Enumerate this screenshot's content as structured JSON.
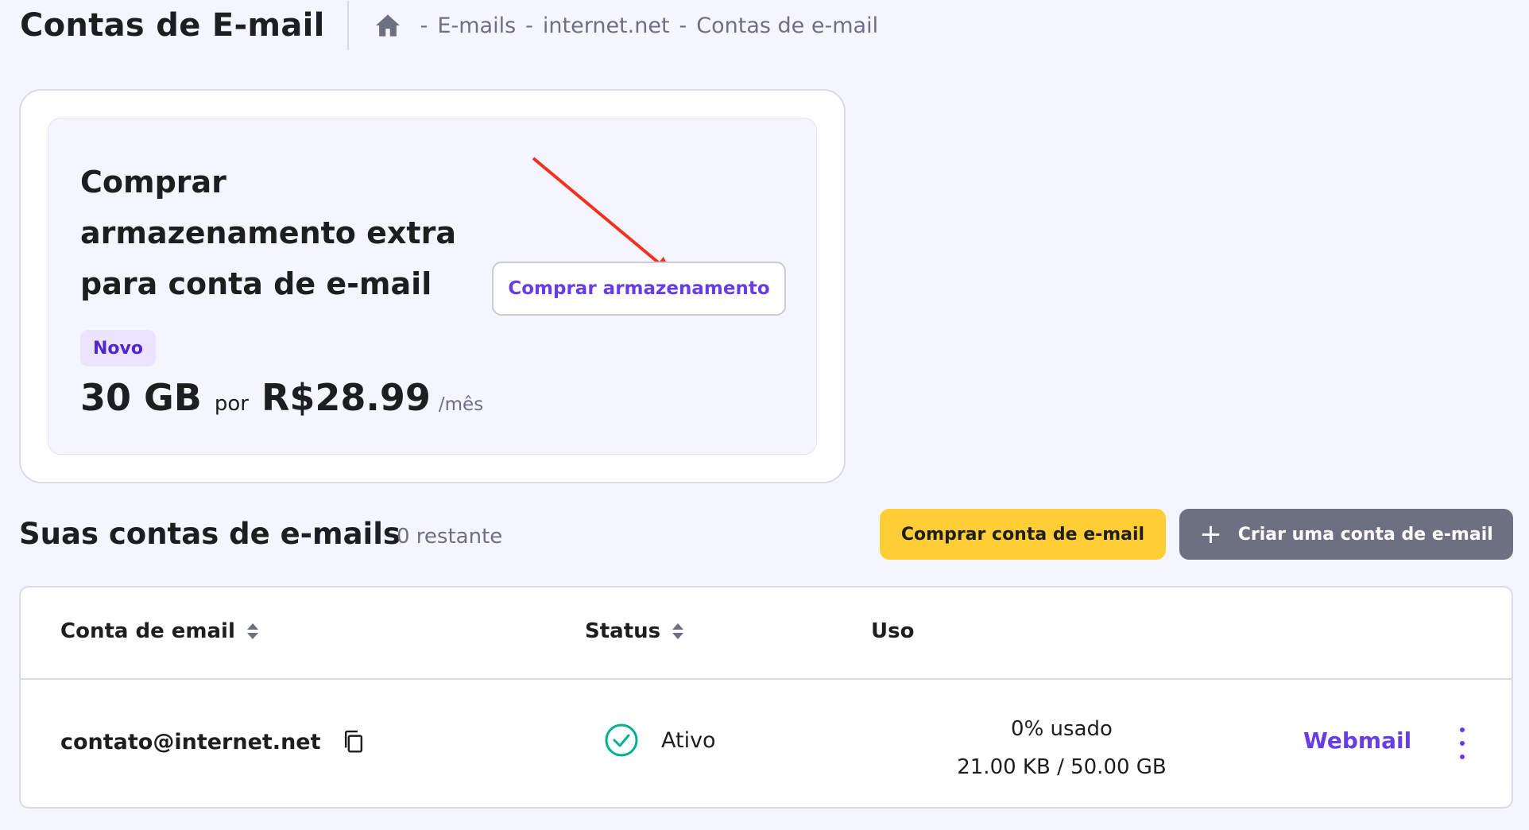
{
  "header": {
    "title": "Contas de E-mail",
    "breadcrumb": {
      "home_icon": "home-icon",
      "items": [
        "E-mails",
        "internet.net",
        "Contas de e-mail"
      ],
      "separator": "-"
    }
  },
  "promo": {
    "title": "Comprar armazenamento extra para conta de e-mail",
    "info_icon": "info-icon",
    "buy_button_label": "Comprar armazenamento",
    "badge": "Novo",
    "size": "30 GB",
    "por": "por",
    "price": "R$28.99",
    "unit": "/mês"
  },
  "accounts": {
    "section_title": "Suas contas de e-mails",
    "remaining": "0 restante",
    "buy_button_label": "Comprar conta de e-mail",
    "create_button_label": "Criar uma conta de e-mail",
    "columns": {
      "email": "Conta de email",
      "status": "Status",
      "usage": "Uso"
    },
    "rows": [
      {
        "email": "contato@internet.net",
        "status": "Ativo",
        "usage_percent": "0% usado",
        "usage_amount": "21.00 KB / 50.00 GB",
        "webmail": "Webmail"
      }
    ]
  },
  "colors": {
    "background": "#f4f5ff",
    "primary": "#673de6",
    "yellow_button": "#ffcd35",
    "grey_button": "#6d7081",
    "status_ok": "#00b090",
    "annotation_arrow": "#f0321e"
  }
}
